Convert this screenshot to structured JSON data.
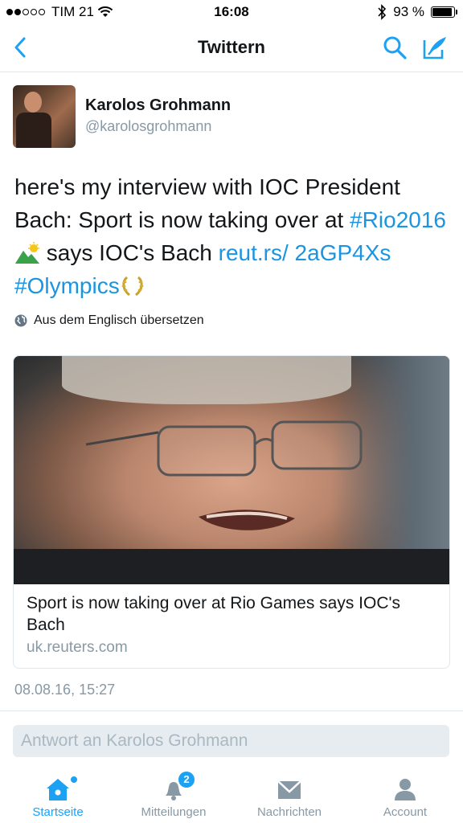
{
  "status_bar": {
    "carrier": "TIM 21",
    "time": "16:08",
    "battery": "93 %",
    "battery_level": 0.93
  },
  "nav": {
    "title": "Twittern",
    "back_icon": "chevron-left-icon",
    "search_icon": "search-icon",
    "compose_icon": "compose-icon"
  },
  "tweet": {
    "author_name": "Karolos Grohmann",
    "author_handle": "@karolosgrohmann",
    "text_part1": "here's my interview with IOC President Bach: Sport is now taking over at ",
    "hashtag1": "#Rio2016",
    "text_part2": " says IOC's Bach ",
    "link": "reut.rs/ 2aGP4Xs",
    "hashtag2": "#Olympics",
    "translate_label": "Aus dem Englisch übersetzen",
    "timestamp": "08.08.16, 15:27"
  },
  "card": {
    "title": "Sport is now taking over at Rio Games says IOC's Bach",
    "domain": "uk.reuters.com"
  },
  "reply": {
    "placeholder": "Antwort an Karolos Grohmann"
  },
  "tabs": [
    {
      "label": "Startseite",
      "icon": "home-icon",
      "active": true
    },
    {
      "label": "Mitteilungen",
      "icon": "bell-icon",
      "badge": "2"
    },
    {
      "label": "Nachrichten",
      "icon": "envelope-icon"
    },
    {
      "label": "Account",
      "icon": "person-icon"
    }
  ],
  "colors": {
    "accent": "#1da1f2",
    "link": "#1b95e0",
    "muted": "#8899a6"
  }
}
